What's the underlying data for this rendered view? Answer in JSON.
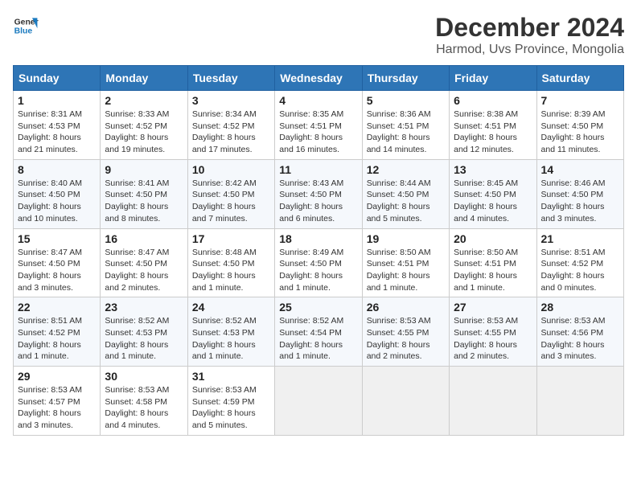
{
  "header": {
    "logo_line1": "General",
    "logo_line2": "Blue",
    "title": "December 2024",
    "subtitle": "Harmod, Uvs Province, Mongolia"
  },
  "days_of_week": [
    "Sunday",
    "Monday",
    "Tuesday",
    "Wednesday",
    "Thursday",
    "Friday",
    "Saturday"
  ],
  "weeks": [
    [
      {
        "day": "1",
        "info": "Sunrise: 8:31 AM\nSunset: 4:53 PM\nDaylight: 8 hours and 21 minutes."
      },
      {
        "day": "2",
        "info": "Sunrise: 8:33 AM\nSunset: 4:52 PM\nDaylight: 8 hours and 19 minutes."
      },
      {
        "day": "3",
        "info": "Sunrise: 8:34 AM\nSunset: 4:52 PM\nDaylight: 8 hours and 17 minutes."
      },
      {
        "day": "4",
        "info": "Sunrise: 8:35 AM\nSunset: 4:51 PM\nDaylight: 8 hours and 16 minutes."
      },
      {
        "day": "5",
        "info": "Sunrise: 8:36 AM\nSunset: 4:51 PM\nDaylight: 8 hours and 14 minutes."
      },
      {
        "day": "6",
        "info": "Sunrise: 8:38 AM\nSunset: 4:51 PM\nDaylight: 8 hours and 12 minutes."
      },
      {
        "day": "7",
        "info": "Sunrise: 8:39 AM\nSunset: 4:50 PM\nDaylight: 8 hours and 11 minutes."
      }
    ],
    [
      {
        "day": "8",
        "info": "Sunrise: 8:40 AM\nSunset: 4:50 PM\nDaylight: 8 hours and 10 minutes."
      },
      {
        "day": "9",
        "info": "Sunrise: 8:41 AM\nSunset: 4:50 PM\nDaylight: 8 hours and 8 minutes."
      },
      {
        "day": "10",
        "info": "Sunrise: 8:42 AM\nSunset: 4:50 PM\nDaylight: 8 hours and 7 minutes."
      },
      {
        "day": "11",
        "info": "Sunrise: 8:43 AM\nSunset: 4:50 PM\nDaylight: 8 hours and 6 minutes."
      },
      {
        "day": "12",
        "info": "Sunrise: 8:44 AM\nSunset: 4:50 PM\nDaylight: 8 hours and 5 minutes."
      },
      {
        "day": "13",
        "info": "Sunrise: 8:45 AM\nSunset: 4:50 PM\nDaylight: 8 hours and 4 minutes."
      },
      {
        "day": "14",
        "info": "Sunrise: 8:46 AM\nSunset: 4:50 PM\nDaylight: 8 hours and 3 minutes."
      }
    ],
    [
      {
        "day": "15",
        "info": "Sunrise: 8:47 AM\nSunset: 4:50 PM\nDaylight: 8 hours and 3 minutes."
      },
      {
        "day": "16",
        "info": "Sunrise: 8:47 AM\nSunset: 4:50 PM\nDaylight: 8 hours and 2 minutes."
      },
      {
        "day": "17",
        "info": "Sunrise: 8:48 AM\nSunset: 4:50 PM\nDaylight: 8 hours and 1 minute."
      },
      {
        "day": "18",
        "info": "Sunrise: 8:49 AM\nSunset: 4:50 PM\nDaylight: 8 hours and 1 minute."
      },
      {
        "day": "19",
        "info": "Sunrise: 8:50 AM\nSunset: 4:51 PM\nDaylight: 8 hours and 1 minute."
      },
      {
        "day": "20",
        "info": "Sunrise: 8:50 AM\nSunset: 4:51 PM\nDaylight: 8 hours and 1 minute."
      },
      {
        "day": "21",
        "info": "Sunrise: 8:51 AM\nSunset: 4:52 PM\nDaylight: 8 hours and 0 minutes."
      }
    ],
    [
      {
        "day": "22",
        "info": "Sunrise: 8:51 AM\nSunset: 4:52 PM\nDaylight: 8 hours and 1 minute."
      },
      {
        "day": "23",
        "info": "Sunrise: 8:52 AM\nSunset: 4:53 PM\nDaylight: 8 hours and 1 minute."
      },
      {
        "day": "24",
        "info": "Sunrise: 8:52 AM\nSunset: 4:53 PM\nDaylight: 8 hours and 1 minute."
      },
      {
        "day": "25",
        "info": "Sunrise: 8:52 AM\nSunset: 4:54 PM\nDaylight: 8 hours and 1 minute."
      },
      {
        "day": "26",
        "info": "Sunrise: 8:53 AM\nSunset: 4:55 PM\nDaylight: 8 hours and 2 minutes."
      },
      {
        "day": "27",
        "info": "Sunrise: 8:53 AM\nSunset: 4:55 PM\nDaylight: 8 hours and 2 minutes."
      },
      {
        "day": "28",
        "info": "Sunrise: 8:53 AM\nSunset: 4:56 PM\nDaylight: 8 hours and 3 minutes."
      }
    ],
    [
      {
        "day": "29",
        "info": "Sunrise: 8:53 AM\nSunset: 4:57 PM\nDaylight: 8 hours and 3 minutes."
      },
      {
        "day": "30",
        "info": "Sunrise: 8:53 AM\nSunset: 4:58 PM\nDaylight: 8 hours and 4 minutes."
      },
      {
        "day": "31",
        "info": "Sunrise: 8:53 AM\nSunset: 4:59 PM\nDaylight: 8 hours and 5 minutes."
      },
      null,
      null,
      null,
      null
    ]
  ]
}
